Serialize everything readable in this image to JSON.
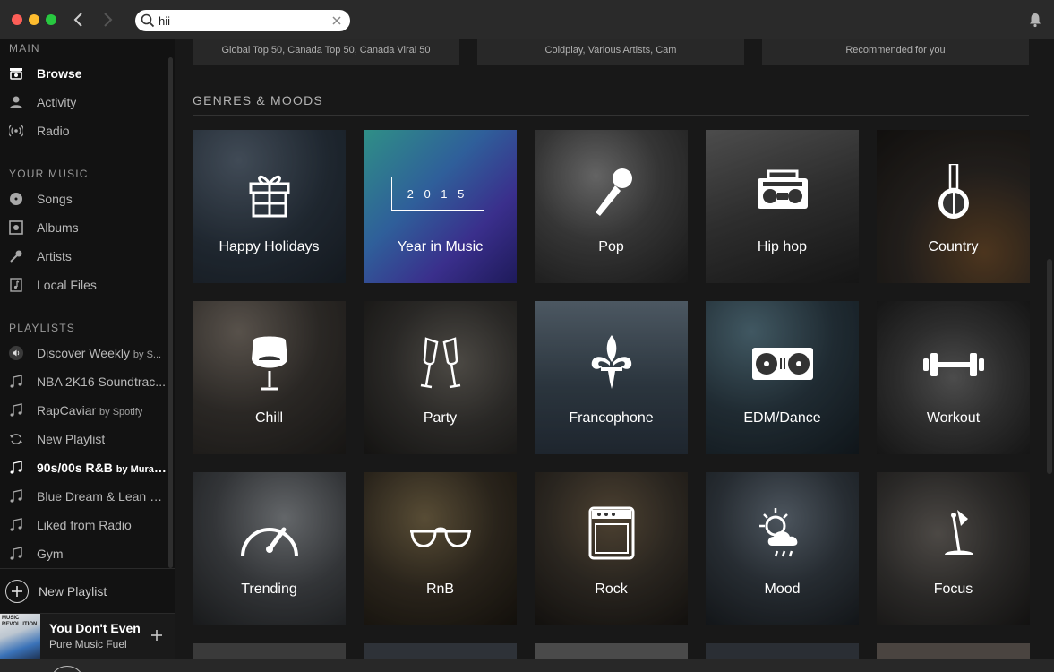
{
  "search": {
    "value": "hii",
    "placeholder": "Search"
  },
  "sidebar": {
    "main_heading": "MAIN",
    "main_items": [
      {
        "label": "Browse",
        "icon": "browse-icon",
        "active": true
      },
      {
        "label": "Activity",
        "icon": "activity-icon"
      },
      {
        "label": "Radio",
        "icon": "radio-icon"
      }
    ],
    "music_heading": "YOUR MUSIC",
    "music_items": [
      {
        "label": "Songs",
        "icon": "songs-icon"
      },
      {
        "label": "Albums",
        "icon": "albums-icon"
      },
      {
        "label": "Artists",
        "icon": "artists-icon"
      },
      {
        "label": "Local Files",
        "icon": "local-files-icon"
      }
    ],
    "playlists_heading": "PLAYLISTS",
    "playlists": [
      {
        "label": "Discover Weekly",
        "by": "by S...",
        "icon": "speaker-icon"
      },
      {
        "label": "NBA 2K16 Soundtrac...",
        "by": "",
        "icon": "music-note-icon"
      },
      {
        "label": "RapCaviar",
        "by": "by Spotify",
        "icon": "music-note-icon"
      },
      {
        "label": "New Playlist",
        "by": "",
        "icon": "sync-icon"
      },
      {
        "label": "90s/00s R&B",
        "by": "by Murat ...",
        "icon": "music-note-icon",
        "bold": true
      },
      {
        "label": "Blue Dream & Lean b...",
        "by": "",
        "icon": "music-note-icon"
      },
      {
        "label": "Liked from Radio",
        "by": "",
        "icon": "music-note-icon"
      },
      {
        "label": "Gym",
        "by": "",
        "icon": "music-note-icon"
      }
    ],
    "new_playlist_label": "New Playlist"
  },
  "now_playing": {
    "title": "You Don't Even I",
    "artist": "Pure Music Fuel",
    "art_text": "MUSIC REVOLUTION"
  },
  "main": {
    "top_cards": [
      "Global Top 50, Canada Top 50, Canada Viral 50",
      "Coldplay, Various Artists, Cam",
      "Recommended for you"
    ],
    "section_title": "GENRES & MOODS",
    "tiles": [
      {
        "label": "Happy Holidays",
        "icon": "gift-icon",
        "color": "#2b3642"
      },
      {
        "label": "Year in Music",
        "icon": "year-badge-icon",
        "color": "#3a3a8c",
        "badge": "2 0 1 5"
      },
      {
        "label": "Pop",
        "icon": "microphone-icon",
        "color": "#4a4a4a"
      },
      {
        "label": "Hip hop",
        "icon": "boombox-icon",
        "color": "#3e3e3e"
      },
      {
        "label": "Country",
        "icon": "banjo-icon",
        "color": "#2f2a26"
      },
      {
        "label": "Chill",
        "icon": "egg-chair-icon",
        "color": "#3b3733"
      },
      {
        "label": "Party",
        "icon": "champagne-icon",
        "color": "#3a3835"
      },
      {
        "label": "Francophone",
        "icon": "fleur-de-lis-icon",
        "color": "#3c4a56"
      },
      {
        "label": "EDM/Dance",
        "icon": "turntable-icon",
        "color": "#2c3c46"
      },
      {
        "label": "Workout",
        "icon": "dumbbell-icon",
        "color": "#3e3e3e"
      },
      {
        "label": "Trending",
        "icon": "gauge-icon",
        "color": "#474a4e"
      },
      {
        "label": "RnB",
        "icon": "sunglasses-icon",
        "color": "#3a3226"
      },
      {
        "label": "Rock",
        "icon": "amplifier-icon",
        "color": "#3a342c"
      },
      {
        "label": "Mood",
        "icon": "weather-icon",
        "color": "#363e46"
      },
      {
        "label": "Focus",
        "icon": "desk-lamp-icon",
        "color": "#3a3836"
      }
    ]
  }
}
